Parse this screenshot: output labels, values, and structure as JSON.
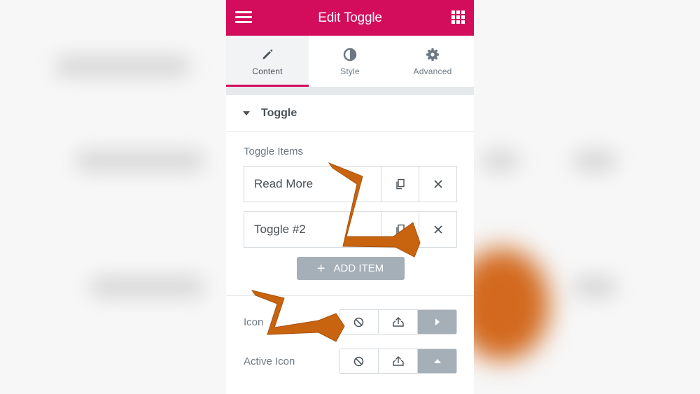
{
  "header": {
    "title": "Edit Toggle",
    "menu_icon": "hamburger-icon",
    "apps_icon": "grid-icon",
    "brand_color": "#d30c5c"
  },
  "tabs": [
    {
      "label": "Content",
      "icon": "pencil-icon",
      "active": true
    },
    {
      "label": "Style",
      "icon": "half-circle-icon",
      "active": false
    },
    {
      "label": "Advanced",
      "icon": "gear-icon",
      "active": false
    }
  ],
  "section": {
    "title": "Toggle"
  },
  "toggle_items": {
    "label": "Toggle Items",
    "items": [
      {
        "title": "Read More"
      },
      {
        "title": "Toggle #2"
      }
    ],
    "add_label": "ADD ITEM"
  },
  "icon_control": {
    "label": "Icon",
    "options": [
      "none-icon",
      "upload-icon",
      "caret-right-icon"
    ],
    "selected": "caret-right-icon"
  },
  "active_icon_control": {
    "label": "Active Icon",
    "options": [
      "none-icon",
      "upload-icon",
      "caret-up-icon"
    ],
    "selected": "caret-up-icon"
  },
  "colors": {
    "annotation_arrow": "#c8640f",
    "control_active": "#a4afb7"
  }
}
